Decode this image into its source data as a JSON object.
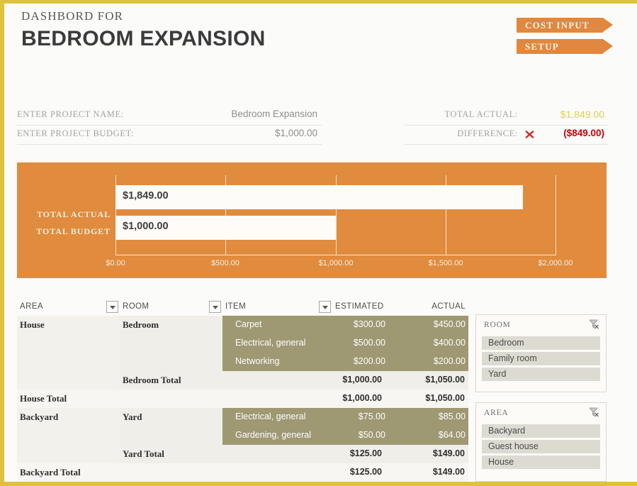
{
  "header": {
    "eyebrow": "DASHBORD FOR",
    "title": "BEDROOM EXPANSION",
    "buttons": [
      {
        "label": "COST INPUT"
      },
      {
        "label": "SETUP"
      }
    ]
  },
  "info": {
    "project_name_label": "ENTER PROJECT NAME:",
    "project_name_value": "Bedroom Expansion",
    "project_budget_label": "ENTER PROJECT BUDGET:",
    "project_budget_value": "$1,000.00",
    "total_actual_label": "TOTAL ACTUAL:",
    "total_actual_value": "$1,849.00",
    "difference_label": "DIFFERENCE:",
    "difference_value": "($849.00)",
    "difference_icon": "red-x-icon"
  },
  "colors": {
    "orange": "#e08b3e",
    "gold_border": "#ddc23c",
    "gold_text": "#e2cf4c",
    "red": "#cc0000",
    "olive": "#9e9873"
  },
  "chart_data": {
    "type": "bar",
    "orientation": "horizontal",
    "title": "",
    "categories": [
      "TOTAL ACTUAL",
      "TOTAL BUDGET"
    ],
    "values": [
      1849.0,
      1000.0
    ],
    "data_labels": [
      "$1,849.00",
      "$1,000.00"
    ],
    "xlabel": "",
    "ylabel": "",
    "xlim": [
      0,
      2000
    ],
    "xticks": [
      0,
      500,
      1000,
      1500,
      2000
    ],
    "xtick_labels": [
      "$0.00",
      "$500.00",
      "$1,000.00",
      "$1,500.00",
      "$2,000.00"
    ],
    "grid": true,
    "legend": "none",
    "plot_background": "#e08b3e",
    "bar_color": "#fdfcf9"
  },
  "table": {
    "headers": {
      "area": "AREA",
      "room": "ROOM",
      "item": "ITEM",
      "estimated": "ESTIMATED",
      "actual": "ACTUAL"
    },
    "rows": [
      {
        "kind": "item",
        "area": "House",
        "room": "Bedroom",
        "item": "Carpet",
        "estimated": "$300.00",
        "actual": "$450.00"
      },
      {
        "kind": "item",
        "area": "",
        "room": "",
        "item": "Electrical, general",
        "estimated": "$500.00",
        "actual": "$400.00"
      },
      {
        "kind": "item",
        "area": "",
        "room": "",
        "item": "Networking",
        "estimated": "$200.00",
        "actual": "$200.00"
      },
      {
        "kind": "subtotal",
        "area": "",
        "room": "Bedroom Total",
        "item": "",
        "estimated": "$1,000.00",
        "actual": "$1,050.00"
      },
      {
        "kind": "grandtotal",
        "area": "House Total",
        "room": "",
        "item": "",
        "estimated": "$1,000.00",
        "actual": "$1,050.00"
      },
      {
        "kind": "item",
        "area": "Backyard",
        "room": "Yard",
        "item": "Electrical, general",
        "estimated": "$75.00",
        "actual": "$85.00"
      },
      {
        "kind": "item",
        "area": "",
        "room": "",
        "item": "Gardening, general",
        "estimated": "$50.00",
        "actual": "$64.00"
      },
      {
        "kind": "subtotal",
        "area": "",
        "room": "Yard Total",
        "item": "",
        "estimated": "$125.00",
        "actual": "$149.00"
      },
      {
        "kind": "grandtotal",
        "area": "Backyard Total",
        "room": "",
        "item": "",
        "estimated": "$125.00",
        "actual": "$149.00"
      }
    ]
  },
  "slicers": [
    {
      "title": "ROOM",
      "clear_icon": "clear-filter-icon",
      "items": [
        "Bedroom",
        "Family room",
        "Yard"
      ]
    },
    {
      "title": "AREA",
      "clear_icon": "clear-filter-icon",
      "items": [
        "Backyard",
        "Guest house",
        "House"
      ]
    }
  ]
}
